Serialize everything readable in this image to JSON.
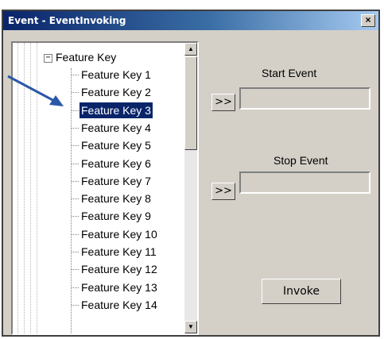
{
  "window": {
    "title": "Event - EventInvoking",
    "close_label": "×"
  },
  "tree": {
    "root_label": "Feature Key",
    "expander": "−",
    "items": [
      "Feature Key 1",
      "Feature Key 2",
      "Feature Key 3",
      "Feature Key 4",
      "Feature Key 5",
      "Feature Key 6",
      "Feature Key 7",
      "Feature Key 8",
      "Feature Key 9",
      "Feature Key 10",
      "Feature Key 11",
      "Feature Key 12",
      "Feature Key 13",
      "Feature Key 14"
    ],
    "selected": "Feature Key 3",
    "scroll_up": "▲",
    "scroll_down": "▼"
  },
  "start_event": {
    "label": "Start Event",
    "button": ">>",
    "value": ""
  },
  "stop_event": {
    "label": "Stop Event",
    "button": ">>",
    "value": ""
  },
  "invoke": {
    "label": "Invoke"
  },
  "colors": {
    "title_start": "#0a246a",
    "title_end": "#a6caf0",
    "selection": "#0a246a",
    "arrow": "#2b57a8"
  }
}
